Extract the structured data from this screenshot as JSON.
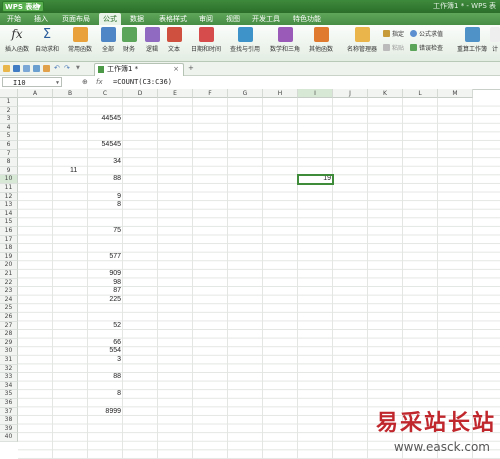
{
  "app": {
    "name": "WPS 表格",
    "window_title": "工作簿1 * - WPS 表"
  },
  "menu": [
    "开始",
    "插入",
    "页面布局",
    "公式",
    "数据",
    "表格样式",
    "审阅",
    "视图",
    "开发工具",
    "特色功能"
  ],
  "ribbon": {
    "insert_function": "插入函数",
    "autosum": "自动求和",
    "common": "常用函数",
    "all": "全部",
    "finance": "财务",
    "logic": "逻辑",
    "text": "文本",
    "datetime": "日期和时间",
    "lookup": "查找与引用",
    "math": "数学和三角",
    "other": "其他函数",
    "name_manager": "名称管理器",
    "paste": "粘贴",
    "specify": "指定",
    "formula_eval": "公式求值",
    "error_check": "错误检查",
    "recalc": "重算工作簿",
    "calc_partial": "计"
  },
  "doc_tab": {
    "name": "工作簿1 *",
    "close": "×",
    "new": "+"
  },
  "formula_bar": {
    "name_box": "I10",
    "zoom": "⊕",
    "fx": "fx",
    "formula": "=COUNT(C3:C36)"
  },
  "columns": [
    "A",
    "B",
    "C",
    "D",
    "E",
    "F",
    "G",
    "H",
    "I",
    "J",
    "K",
    "L",
    "M"
  ],
  "selected_column": "I",
  "rows": [
    "1",
    "2",
    "3",
    "4",
    "5",
    "6",
    "7",
    "8",
    "9",
    "10",
    "11",
    "12",
    "13",
    "14",
    "15",
    "16",
    "17",
    "18",
    "19",
    "20",
    "21",
    "22",
    "23",
    "24",
    "25",
    "26",
    "27",
    "28",
    "29",
    "30",
    "31",
    "32",
    "33",
    "34",
    "35",
    "36",
    "37",
    "38",
    "39",
    "40"
  ],
  "selected_row": "10",
  "cells": {
    "C3": "44545",
    "C6": "54545",
    "C8": "34",
    "B9": "11",
    "C10": "88",
    "C12": "9",
    "C13": "8",
    "C16": "75",
    "C19": "577",
    "C21": "909",
    "C22": "98",
    "C23": "87",
    "C24": "225",
    "C27": "52",
    "C29": "66",
    "C30": "554",
    "C31": "3",
    "C33": "88",
    "C35": "8",
    "C37": "8999",
    "I10": "19"
  },
  "watermark": {
    "brand": "易采站长站",
    "url": "www.easck.com"
  },
  "colors": {
    "accent": "#3f8c3b",
    "brand_red": "#c0272d"
  }
}
